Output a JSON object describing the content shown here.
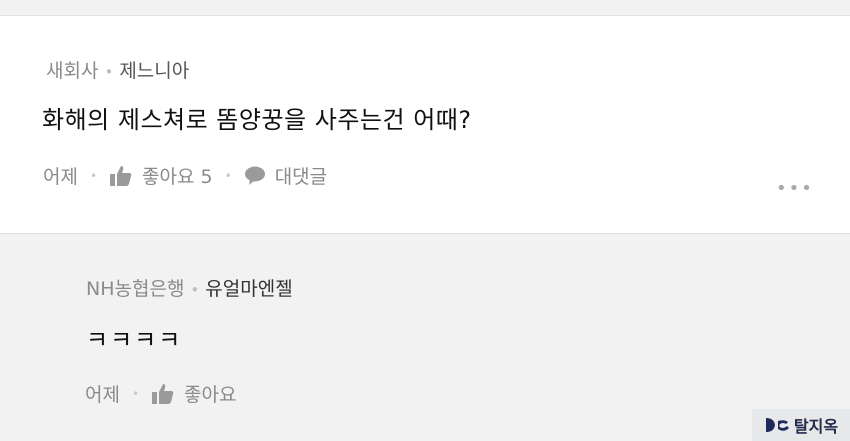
{
  "comment": {
    "author_meta": "새회사",
    "author_name": "제느니아",
    "text": "화해의 제스쳐로 똠양꿍을 사주는건 어때?",
    "time": "어제",
    "like_label": "좋아요 5",
    "reply_label": "대댓글",
    "more_label": "•••",
    "icons": [
      "thumbs-up-icon",
      "speech-bubble-icon",
      "more-dots-icon"
    ]
  },
  "reply": {
    "author_meta": "NH농협은행",
    "author_name": "유얼마엔젤",
    "text": "ㅋㅋㅋㅋ",
    "time": "어제",
    "like_label": "좋아요",
    "icons": [
      "thumbs-up-icon"
    ]
  },
  "watermark": {
    "text": "탈지옥"
  },
  "colors": {
    "background": "#f2f2f2",
    "card": "#ffffff",
    "meta_text": "#8a8a8a",
    "body_text": "#111111"
  }
}
